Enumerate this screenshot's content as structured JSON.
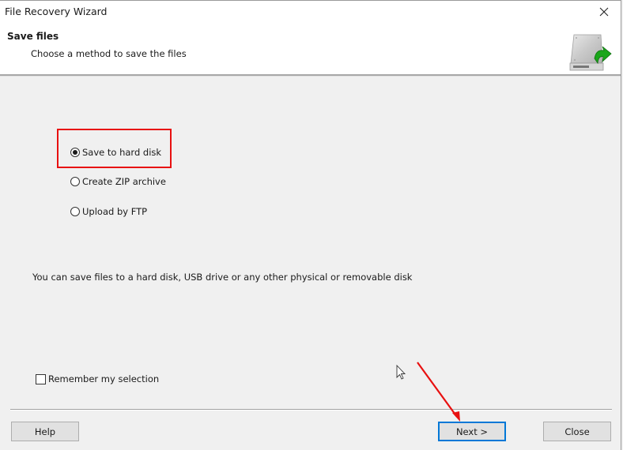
{
  "window": {
    "title": "File Recovery Wizard",
    "close_icon": "close-icon"
  },
  "header": {
    "title": "Save files",
    "subtitle": "Choose a method to save the files",
    "icon": "hard-disk-save-icon"
  },
  "options": [
    {
      "label": "Save to hard disk",
      "checked": true
    },
    {
      "label": "Create ZIP archive",
      "checked": false
    },
    {
      "label": "Upload by FTP",
      "checked": false
    }
  ],
  "info_text": "You can save files to a hard disk, USB drive or any other physical or removable disk",
  "remember": {
    "label": "Remember my selection",
    "checked": false
  },
  "buttons": {
    "help": "Help",
    "next": "Next >",
    "close": "Close"
  },
  "annotations": {
    "highlight_color": "#e81010",
    "arrow_color": "#e81010",
    "accent_color": "#0078d7"
  }
}
